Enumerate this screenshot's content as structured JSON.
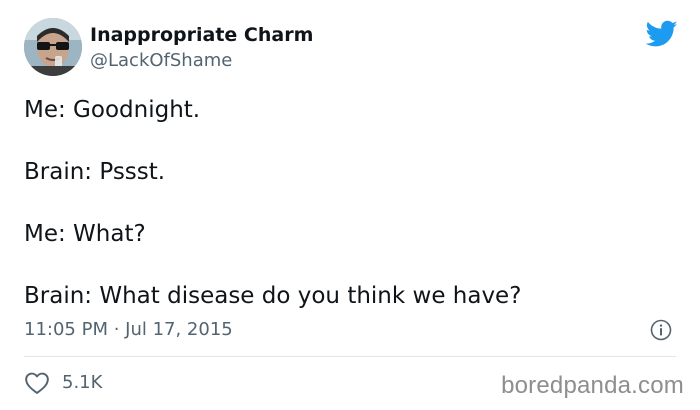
{
  "author": {
    "display_name": "Inappropriate Charm",
    "handle": "@LackOfShame",
    "avatar_icon": "profile-photo"
  },
  "header": {
    "logo_icon": "twitter-bird-icon",
    "logo_color": "#1d9bf0"
  },
  "tweet": {
    "lines": [
      "Me: Goodnight.",
      "Brain: Pssst.",
      "Me: What?",
      "Brain: What disease do you think we have?"
    ]
  },
  "meta": {
    "timestamp": "11:05 PM · Jul 17, 2015",
    "info_icon": "info-icon"
  },
  "actions": {
    "like_icon": "heart-icon",
    "like_count": "5.1K"
  },
  "watermark": {
    "text": "boredpanda.com"
  },
  "colors": {
    "text_primary": "#0f1419",
    "text_secondary": "#536471",
    "divider": "#e1e8ed",
    "watermark": "#8e8e8e"
  }
}
